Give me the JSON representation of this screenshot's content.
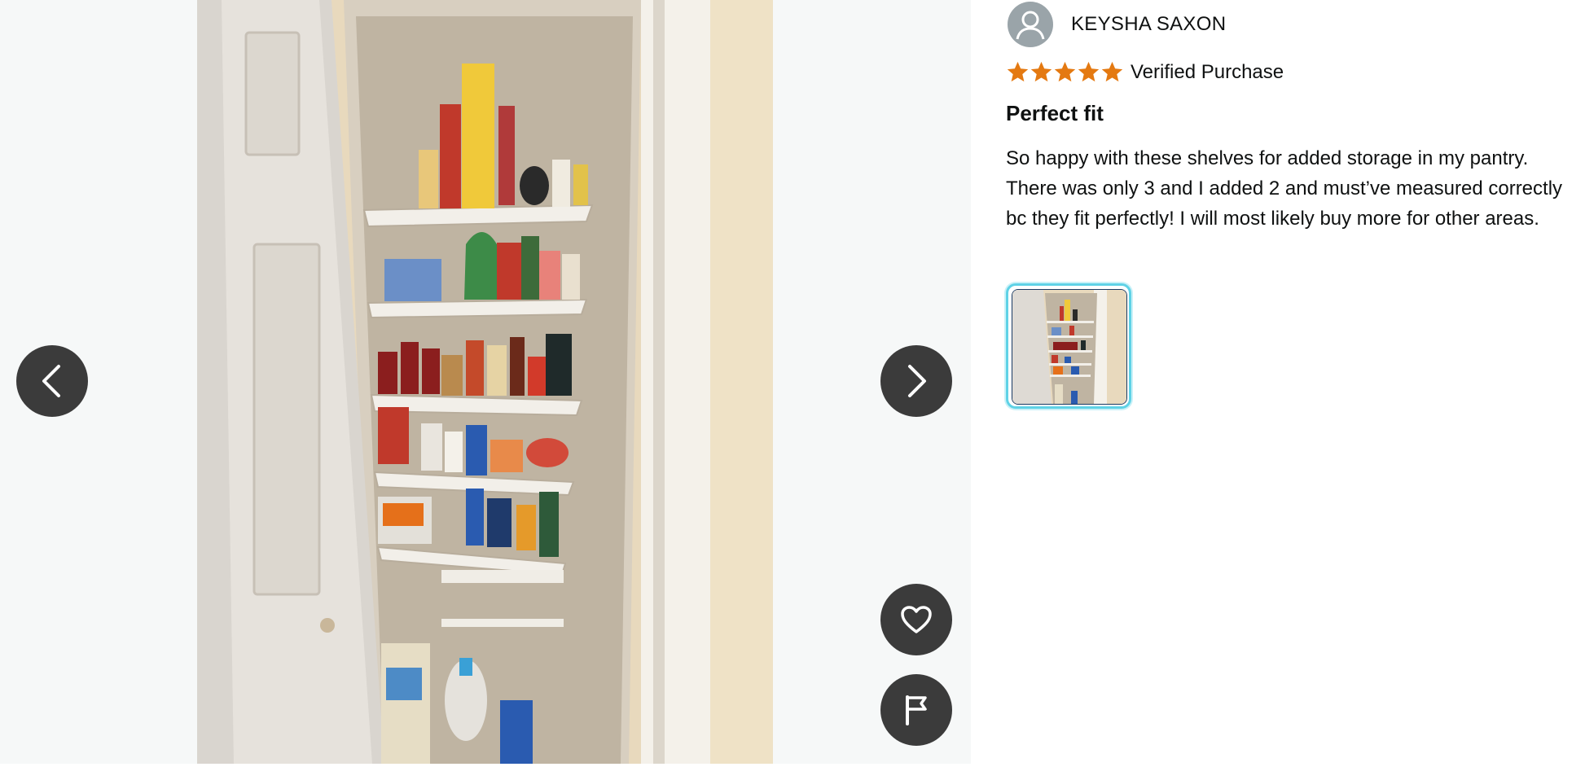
{
  "viewer": {
    "image_alt": "Pantry shelves photo",
    "nav": {
      "prev_icon": "chevron-left-icon",
      "next_icon": "chevron-right-icon"
    },
    "actions": {
      "like_icon": "heart-icon",
      "report_icon": "flag-icon"
    }
  },
  "review": {
    "reviewer_name": "KEYSHA SAXON",
    "rating": 5,
    "rating_max": 5,
    "star_color": "#e47911",
    "badge": "Verified Purchase",
    "title": "Perfect fit",
    "body": "So happy with these shelves for added storage in my pantry. There was only 3 and I added 2 and must’ve measured correctly bc they fit perfectly! I will most likely buy more for other areas.",
    "thumbnail_border_color": "#5fd2e6"
  }
}
